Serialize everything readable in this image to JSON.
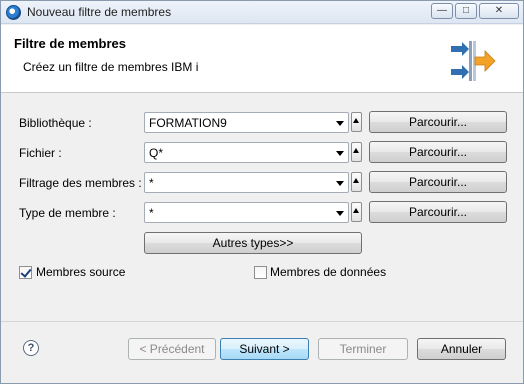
{
  "window": {
    "title": "Nouveau filtre de membres"
  },
  "header": {
    "title": "Filtre de membres",
    "description": "Créez un filtre de membres IBM i"
  },
  "form": {
    "rows": [
      {
        "label": "Bibliothèque :",
        "value": "FORMATION9",
        "browse_label": "Parcourir..."
      },
      {
        "label": "Fichier :",
        "value": "Q*",
        "browse_label": "Parcourir..."
      },
      {
        "label": "Filtrage des membres :",
        "value": "*",
        "browse_label": "Parcourir..."
      },
      {
        "label": "Type de membre :",
        "value": "*",
        "browse_label": "Parcourir..."
      }
    ],
    "other_types_label": "Autres types>>",
    "source_members": {
      "label": "Membres source",
      "checked": true
    },
    "data_members": {
      "label": "Membres de données",
      "checked": false
    }
  },
  "footer": {
    "help_icon": "help-icon",
    "previous_label": "< Précédent",
    "next_label": "Suivant >",
    "finish_label": "Terminer",
    "cancel_label": "Annuler"
  },
  "icons": [
    "app-icon",
    "minimize-icon",
    "maximize-icon",
    "close-icon",
    "wizard-arrows-icon",
    "dropdown-arrow-icon",
    "spin-up-icon",
    "help-icon"
  ],
  "colors": {
    "accent": "#3c7fb1",
    "arrow_blue": "#2f6fb2",
    "arrow_orange": "#f2a227"
  }
}
